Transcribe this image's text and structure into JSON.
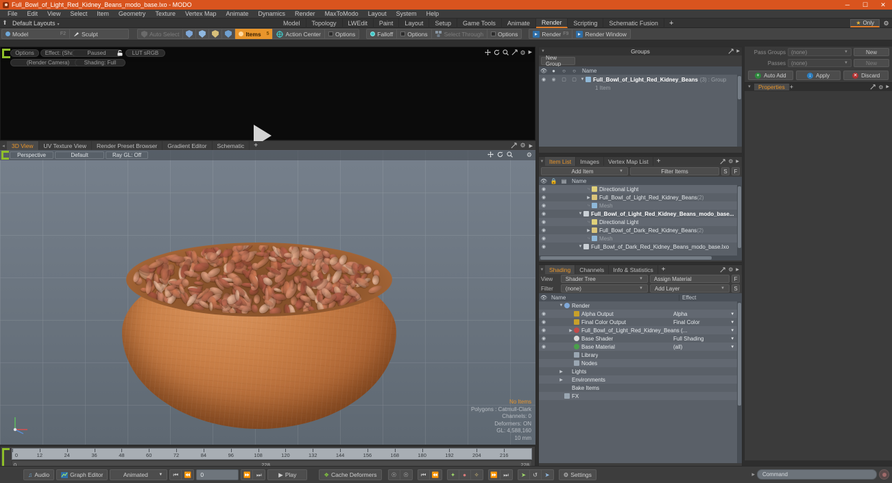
{
  "window": {
    "title": "Full_Bowl_of_Light_Red_Kidney_Beans_modo_base.lxo - MODO",
    "minimize": "─",
    "maximize": "☐",
    "close": "✕"
  },
  "menubar": {
    "items": [
      "File",
      "Edit",
      "View",
      "Select",
      "Item",
      "Geometry",
      "Texture",
      "Vertex Map",
      "Animate",
      "Dynamics",
      "Render",
      "MaxToModo",
      "Layout",
      "System",
      "Help"
    ]
  },
  "layout_row": {
    "home_icon": "⬆",
    "dropdown_label": "Default Layouts",
    "caret": "▾",
    "tabs": [
      {
        "label": "Model",
        "active": false
      },
      {
        "label": "Topology",
        "active": false
      },
      {
        "label": "LWEdit",
        "active": false
      },
      {
        "label": "Paint",
        "active": false
      },
      {
        "label": "Layout",
        "active": false
      },
      {
        "label": "Setup",
        "active": false
      },
      {
        "label": "Game Tools",
        "active": false
      },
      {
        "label": "Animate",
        "active": false
      },
      {
        "label": "Render",
        "active": true
      },
      {
        "label": "Scripting",
        "active": false
      },
      {
        "label": "Schematic Fusion",
        "active": false
      }
    ],
    "plus": "+",
    "only_label": "Only",
    "star": "★",
    "gear": "⚙"
  },
  "toolbar": {
    "model_label": "Model",
    "model_key": "F2",
    "sculpt_label": "Sculpt",
    "auto_select_label": "Auto Select",
    "items_label": "Items",
    "items_key": "5",
    "action_center_label": "Action Center",
    "options_label_1": "Options",
    "falloff_label": "Falloff",
    "options_label_2": "Options",
    "select_through_label": "Select Through",
    "options_label_3": "Options",
    "render_label": "Render",
    "render_key": "F9",
    "render_window_label": "Render Window"
  },
  "render_preview": {
    "options_label": "Options",
    "effect_label": "Effect: (Shadi...",
    "paused_label": "Paused",
    "lut_label": "LUT  sRGB",
    "render_camera_label": "(Render Camera)",
    "shading_label": "Shading: Full",
    "icons": [
      "pan-icon",
      "rotate-icon",
      "zoom-icon",
      "expand-icon",
      "gear-icon",
      "chevron-right-icon"
    ]
  },
  "viewport_tabs": {
    "tabs": [
      {
        "label": "3D View",
        "active": true
      },
      {
        "label": "UV Texture View",
        "active": false
      },
      {
        "label": "Render Preset Browser",
        "active": false
      },
      {
        "label": "Gradient Editor",
        "active": false
      },
      {
        "label": "Schematic",
        "active": false
      }
    ],
    "plus": "+",
    "icons": [
      "pan-icon",
      "rotate-icon",
      "zoom-icon",
      "gear-icon",
      "chevron-right-icon"
    ]
  },
  "viewport3d": {
    "perspective_label": "Perspective",
    "style_label": "Default",
    "rayql_label": "Ray GL: Off",
    "icons": [
      "pan-icon",
      "rotate-icon",
      "zoom-icon",
      "gear-icon"
    ],
    "info": {
      "no_items": "No Items",
      "polygons": "Polygons : Catmull-Clark",
      "channels": "Channels: 0",
      "deformers": "Deformers: ON",
      "gl": "GL: 4,588,160",
      "grid": "10 mm"
    }
  },
  "timeline": {
    "ticks": [
      0,
      12,
      24,
      36,
      48,
      60,
      72,
      84,
      96,
      108,
      120,
      132,
      144,
      156,
      168,
      180,
      192,
      204,
      216
    ],
    "start": "0",
    "mid": "228",
    "end": "228"
  },
  "groups_panel": {
    "title": "Groups",
    "new_group_label": "New Group",
    "column_name": "Name",
    "row": {
      "name": "Full_Bowl_of_Light_Red_Kidney_Beans",
      "count": "(3)",
      "type": ": Group",
      "sub": "1 Item"
    }
  },
  "item_list": {
    "tabs": [
      {
        "label": "Item List",
        "active": true
      },
      {
        "label": "Images",
        "active": false
      },
      {
        "label": "Vertex Map List",
        "active": false
      }
    ],
    "plus": "+",
    "add_item_label": "Add Item",
    "filter_items_label": "Filter Items",
    "s_btn": "S",
    "f_btn": "F",
    "column_name": "Name",
    "rows": [
      {
        "indent": 1,
        "twirl": "▼",
        "icon": "scene-icon",
        "name": "Full_Bowl_of_Dark_Red_Kidney_Beans_modo_base.lxo",
        "suffix": "",
        "bold": false,
        "eye": true,
        "dim": false
      },
      {
        "indent": 2,
        "twirl": "",
        "icon": "mesh-icon",
        "name": "Mesh",
        "suffix": "",
        "bold": false,
        "eye": true,
        "dim": true
      },
      {
        "indent": 2,
        "twirl": "▶",
        "icon": "group-icon",
        "name": "Full_Bowl_of_Dark_Red_Kidney_Beans",
        "suffix": "(2)",
        "bold": false,
        "eye": true,
        "dim": false
      },
      {
        "indent": 2,
        "twirl": "",
        "icon": "light-icon",
        "name": "Directional Light",
        "suffix": "",
        "bold": false,
        "eye": true,
        "dim": false
      },
      {
        "indent": 1,
        "twirl": "▼",
        "icon": "scene-icon",
        "name": "Full_Bowl_of_Light_Red_Kidney_Beans_modo_base...",
        "suffix": "",
        "bold": true,
        "eye": true,
        "dim": false
      },
      {
        "indent": 2,
        "twirl": "",
        "icon": "mesh-icon",
        "name": "Mesh",
        "suffix": "",
        "bold": false,
        "eye": true,
        "dim": true
      },
      {
        "indent": 2,
        "twirl": "▶",
        "icon": "group-icon",
        "name": "Full_Bowl_of_Light_Red_Kidney_Beans",
        "suffix": "(2)",
        "bold": false,
        "eye": true,
        "dim": false
      },
      {
        "indent": 2,
        "twirl": "",
        "icon": "light-icon",
        "name": "Directional Light",
        "suffix": "",
        "bold": false,
        "eye": true,
        "dim": false
      }
    ]
  },
  "shading_panel": {
    "tabs": [
      {
        "label": "Shading",
        "active": true
      },
      {
        "label": "Channels",
        "active": false
      },
      {
        "label": "Info & Statistics",
        "active": false
      }
    ],
    "plus": "+",
    "view_label": "View",
    "view_value": "Shader Tree",
    "assign_material_label": "Assign Material",
    "f_btn": "F",
    "filter_label": "Filter",
    "filter_value": "(none)",
    "add_layer_label": "Add Layer",
    "s_btn": "S",
    "column_name": "Name",
    "column_effect": "Effect",
    "rows": [
      {
        "indent": 0,
        "twirl": "▼",
        "icon": "render-icon",
        "color": "#7fa8d8",
        "name": "Render",
        "effect": "",
        "eye": false
      },
      {
        "indent": 1,
        "twirl": "",
        "icon": "output-icon",
        "color": "#c8a02a",
        "name": "Alpha Output",
        "effect": "Alpha",
        "eye": true
      },
      {
        "indent": 1,
        "twirl": "",
        "icon": "output-icon",
        "color": "#c8a02a",
        "name": "Final Color Output",
        "effect": "Final Color",
        "eye": true
      },
      {
        "indent": 1,
        "twirl": "▶",
        "icon": "material-icon",
        "color": "#c24a4a",
        "name": "Full_Bowl_of_Light_Red_Kidney_Beans (...",
        "effect": "",
        "eye": true
      },
      {
        "indent": 1,
        "twirl": "",
        "icon": "shader-icon",
        "color": "#d8d8d8",
        "name": "Base Shader",
        "effect": "Full Shading",
        "eye": true
      },
      {
        "indent": 1,
        "twirl": "",
        "icon": "material-icon",
        "color": "#4aa04a",
        "name": "Base Material",
        "effect": "(all)",
        "eye": true
      },
      {
        "indent": 1,
        "twirl": "",
        "icon": "folder-icon",
        "color": "#9aa6b2",
        "name": "Library",
        "effect": "",
        "eye": false
      },
      {
        "indent": 1,
        "twirl": "",
        "icon": "folder-icon",
        "color": "#9aa6b2",
        "name": "Nodes",
        "effect": "",
        "eye": false
      },
      {
        "indent": 0,
        "twirl": "▶",
        "icon": "",
        "color": "",
        "name": "Lights",
        "effect": "",
        "eye": false
      },
      {
        "indent": 0,
        "twirl": "▶",
        "icon": "",
        "color": "",
        "name": "Environments",
        "effect": "",
        "eye": false
      },
      {
        "indent": 0,
        "twirl": "",
        "icon": "",
        "color": "",
        "name": "Bake Items",
        "effect": "",
        "eye": false
      },
      {
        "indent": 0,
        "twirl": "",
        "icon": "fx-icon",
        "color": "#9aa6b2",
        "name": "FX",
        "effect": "",
        "eye": false
      }
    ]
  },
  "right_column": {
    "pass_groups_label": "Pass Groups",
    "pass_groups_value": "(none)",
    "pass_groups_new": "New",
    "passes_label": "Passes",
    "passes_value": "(none)",
    "passes_new": "New",
    "auto_add_label": "Auto Add",
    "apply_label": "Apply",
    "discard_label": "Discard",
    "properties_tab": "Properties",
    "plus": "+"
  },
  "bottom_bar": {
    "audio_label": "Audio",
    "graph_editor_label": "Graph Editor",
    "animated_label": "Animated",
    "frame_value": "0",
    "play_label": "Play",
    "cache_deformers_label": "Cache Deformers",
    "settings_label": "Settings",
    "command_placeholder": "Command",
    "transport": {
      "first": "◀❘",
      "prev": "◁",
      "next": "▷",
      "last": "❘▶"
    }
  },
  "colors": {
    "accent": "#e8952b",
    "titlebar": "#d9541e",
    "panel_bg": "#3d3d3d",
    "list_bg": "#5a6068",
    "list_header": "#4a5058",
    "viewport_bg": "#6c7681",
    "green_marker": "#8fbf2a"
  }
}
